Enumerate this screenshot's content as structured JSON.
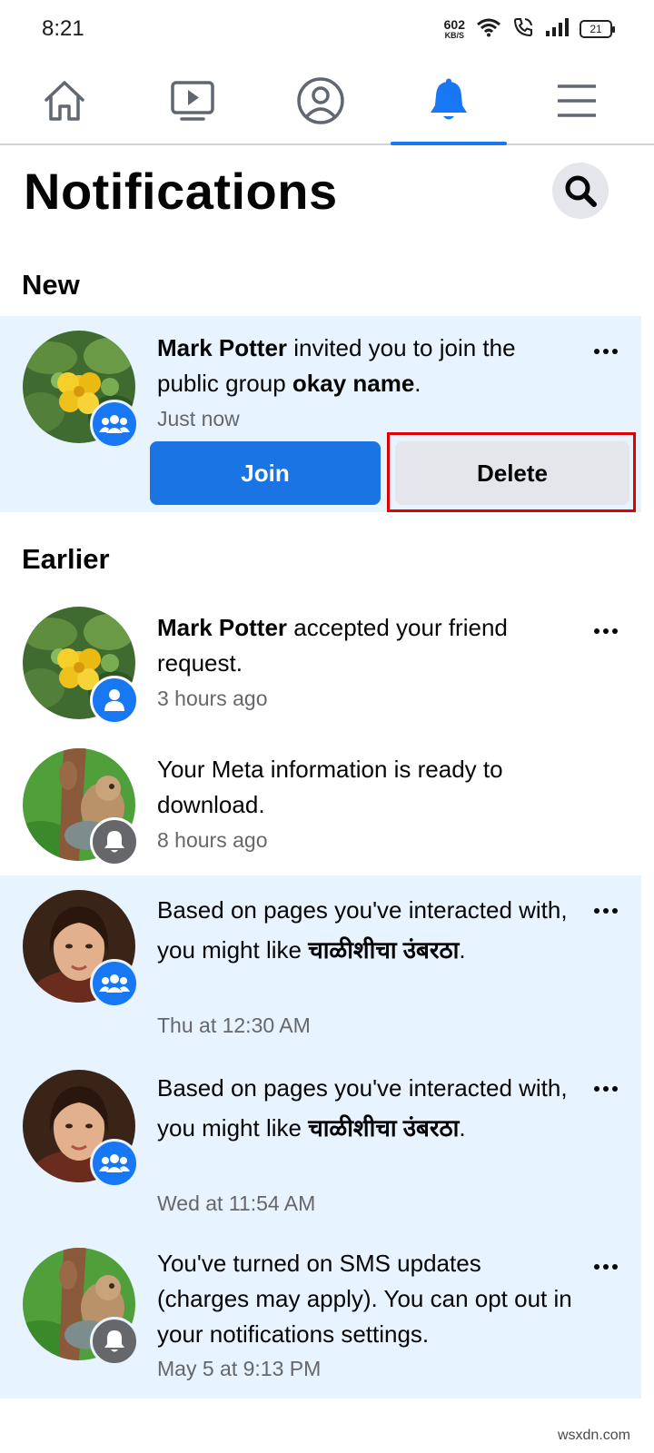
{
  "status_bar": {
    "time": "8:21",
    "net_speed": "602",
    "net_unit": "KB/S",
    "battery": "21"
  },
  "nav": {
    "active": "notifications",
    "accent_color": "#1877f2"
  },
  "header": {
    "title": "Notifications",
    "search_icon": "search-icon"
  },
  "sections": {
    "new": "New",
    "earlier": "Earlier"
  },
  "new_notification": {
    "actor": "Mark Potter",
    "text_1": " invited you to join the public group ",
    "group": "okay name",
    "text_2": ".",
    "time": "Just now",
    "badge": "group-icon",
    "join_label": "Join",
    "delete_label": "Delete"
  },
  "earlier_notifications": [
    {
      "actor": "Mark Potter",
      "text": " accepted your friend request.",
      "time": "3 hours ago",
      "badge": "person-icon",
      "unread": false
    },
    {
      "text": "Your Meta information is ready to download.",
      "time": "8 hours ago",
      "badge": "bell-icon",
      "unread": false
    },
    {
      "text_1": "Based on pages you've interacted with, you might like ",
      "page": "चाळीशीचा उंबरठा",
      "text_2": ".",
      "time": "Thu at 12:30 AM",
      "badge": "group-icon",
      "unread": true
    },
    {
      "text_1": "Based on pages you've interacted with, you might like ",
      "page": "चाळीशीचा उंबरठा",
      "text_2": ".",
      "time": "Wed at 11:54 AM",
      "badge": "group-icon",
      "unread": true
    },
    {
      "text": "You've turned on SMS updates (charges may apply). You can opt out in your notifications settings.",
      "time": "May 5 at 9:13 PM",
      "badge": "bell-icon",
      "unread": true
    }
  ],
  "watermark": "wsxdn.com"
}
